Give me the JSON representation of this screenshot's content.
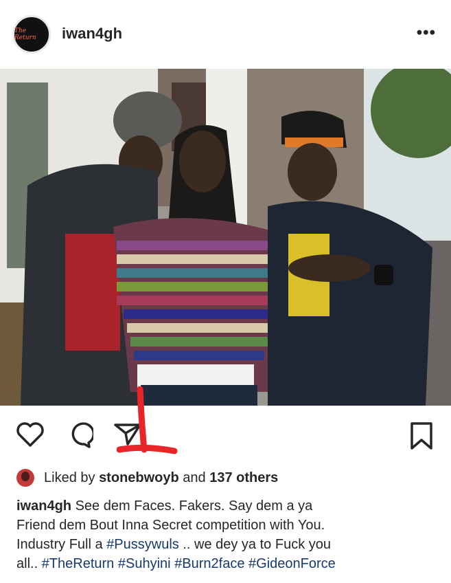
{
  "post": {
    "username": "iwan4gh",
    "avatar_text": "The Return",
    "more_icon": "more-horizontal-icon",
    "photo_description_icon": "post-photo"
  },
  "actions": {
    "like_icon": "heart-outline-icon",
    "comment_icon": "comment-bubble-icon",
    "share_icon": "paper-plane-icon",
    "save_icon": "bookmark-outline-icon"
  },
  "likes": {
    "prefix": "Liked by ",
    "user": "stonebwoyb",
    "middle": " and ",
    "count": "137 others"
  },
  "caption": {
    "username": "iwan4gh",
    "line1": " See dem Faces. Fakers. Say dem a ya",
    "line2": "Friend dem Bout Inna Secret competition with You.",
    "line3_prefix": "Industry Full a ",
    "tag1": "#Pussywuls",
    "line3_suffix": " .. we dey ya to Fuck you",
    "line4_prefix": "all.. ",
    "tag2": "#TheReturn",
    "tag3": "#Suhyini",
    "tag4": "#Burn2face",
    "tag5": "#GideonForce"
  },
  "colors": {
    "text": "#262626",
    "hashtag": "#173a6b",
    "annotation": "#e8262a"
  }
}
